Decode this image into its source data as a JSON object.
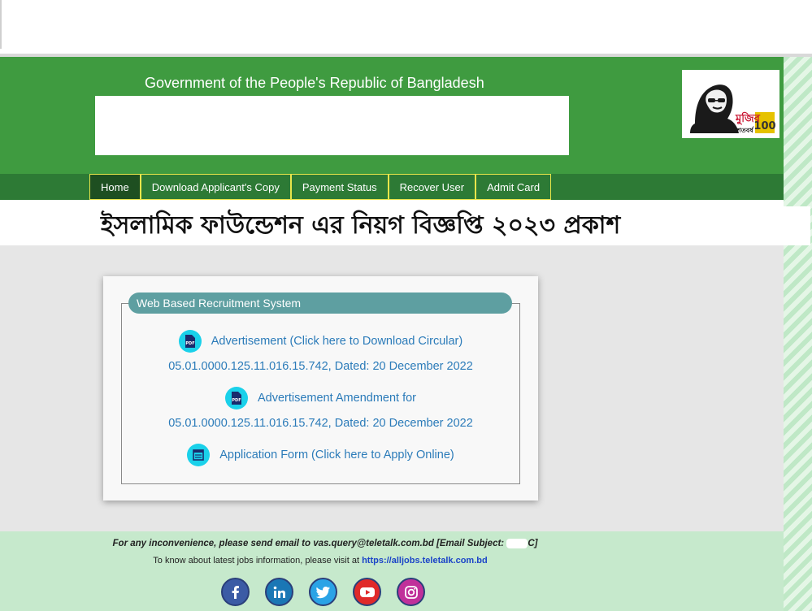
{
  "header": {
    "gov_title": "Government of the People's Republic of Bangladesh",
    "logo_text_primary": "মুজিব",
    "logo_text_secondary": "শতবর্ষ",
    "logo_text_number": "100"
  },
  "nav": {
    "items": [
      {
        "label": "Home"
      },
      {
        "label": "Download Applicant's Copy"
      },
      {
        "label": "Payment Status"
      },
      {
        "label": "Recover User"
      },
      {
        "label": "Admit Card"
      }
    ]
  },
  "banner": {
    "headline": "ইসলামিক ফাউন্ডেশন এর নিয়গ বিজ্ঞপ্তি ২০২৩ প্রকাশ"
  },
  "panel": {
    "legend": "Web Based Recruitment System",
    "advertisement_link": "Advertisement (Click here to Download Circular)",
    "advertisement_ref": "05.01.0000.125.11.016.15.742, Dated: 20 December 2022",
    "amendment_link": "Advertisement Amendment for",
    "amendment_ref": "05.01.0000.125.11.016.15.742, Dated: 20 December 2022",
    "application_link": "Application Form (Click here to Apply Online)",
    "pdf_icon_label": "PDF"
  },
  "footer": {
    "contact_prefix": "For any inconvenience, please send email to vas.query@teletalk.com.bd [Email Subject: ",
    "contact_suffix": "C]",
    "jobs_text": "To know about latest jobs information, please visit at ",
    "jobs_link": "https://alljobs.teletalk.com.bd",
    "socials": [
      "facebook-icon",
      "linkedin-icon",
      "twitter-icon",
      "youtube-icon",
      "instagram-icon"
    ]
  },
  "colors": {
    "header_green": "#3f9b40",
    "nav_green": "#2d7a35",
    "legend_teal": "#5e9fa1",
    "link_blue": "#2b7bb9",
    "icon_cyan": "#1ad1ea",
    "footer_green": "#c6e9cc"
  }
}
